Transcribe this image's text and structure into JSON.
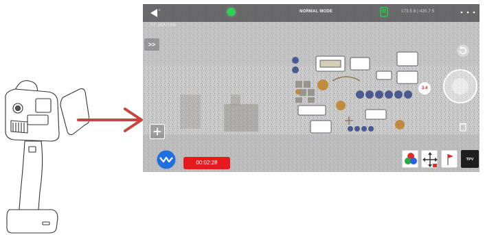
{
  "app": {
    "mode_label": "NORMAL MODE",
    "coordinates": "173.5 8 | 420.7 5",
    "breadcrumb": "PT_REALTIME",
    "expand_label": ">>",
    "distance_value": "3.4",
    "timer": "00:02:28",
    "tpv_label": "TPV"
  },
  "colors": {
    "timer_bg": "#e8181c",
    "status_dot": "#21d64a",
    "logo_bg": "#1f6fde",
    "arrow": "#c8453d"
  },
  "icons": [
    "back-arrow-icon",
    "status-dot-icon",
    "device-icon",
    "more-dots-icon",
    "refresh-icon",
    "joystick-icon",
    "trash-icon",
    "plus-icon",
    "logo-icon",
    "color-mode-icon",
    "move-icon",
    "flag-icon"
  ]
}
